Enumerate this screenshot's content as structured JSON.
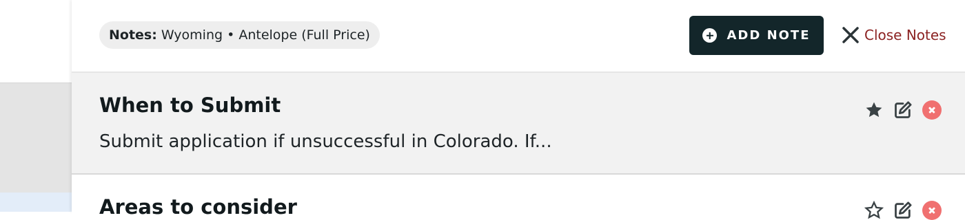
{
  "header": {
    "context_label": "Notes:",
    "context_value": "Wyoming • Antelope (Full Price)",
    "add_note_label": "ADD NOTE",
    "close_label": "Close Notes"
  },
  "notes": [
    {
      "title": "When to Submit",
      "body": "Submit application if unsuccessful in Colorado. If...",
      "starred": true
    },
    {
      "title": "Areas to consider",
      "body": "",
      "starred": false
    }
  ],
  "icons": {
    "add": "plus-circle-icon",
    "close": "close-icon",
    "star": "star-icon",
    "edit": "edit-icon",
    "delete": "delete-icon"
  },
  "colors": {
    "primary_button": "#13262a",
    "close_link": "#8b2222",
    "delete": "#f07070",
    "note_highlight_bg": "#f2f2f2"
  }
}
